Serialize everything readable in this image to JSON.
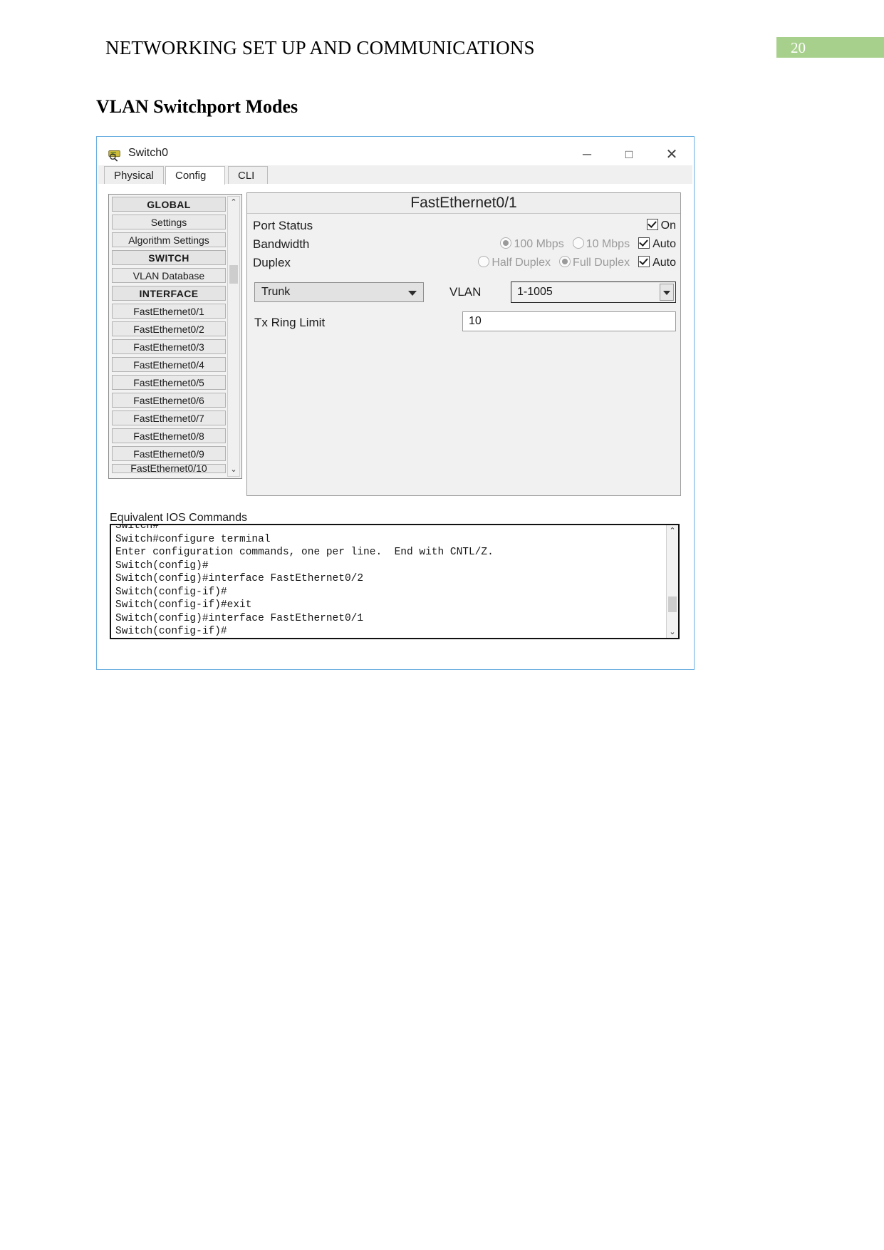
{
  "document": {
    "header_title": "NETWORKING SET UP AND COMMUNICATIONS",
    "page_number": "20",
    "section_heading": "VLAN Switchport Modes",
    "badge_color": "#a8d08d"
  },
  "window": {
    "title": "Switch0",
    "minimize": "─",
    "maximize": "□",
    "close": "✕"
  },
  "tabs": [
    {
      "label": "Physical",
      "active": false
    },
    {
      "label": "Config",
      "active": true
    },
    {
      "label": "CLI",
      "active": false
    }
  ],
  "sidebar": {
    "items": [
      {
        "label": "GLOBAL",
        "type": "header"
      },
      {
        "label": "Settings",
        "type": "item"
      },
      {
        "label": "Algorithm Settings",
        "type": "item"
      },
      {
        "label": "SWITCH",
        "type": "header"
      },
      {
        "label": "VLAN Database",
        "type": "item"
      },
      {
        "label": "INTERFACE",
        "type": "header"
      },
      {
        "label": "FastEthernet0/1",
        "type": "item"
      },
      {
        "label": "FastEthernet0/2",
        "type": "item"
      },
      {
        "label": "FastEthernet0/3",
        "type": "item"
      },
      {
        "label": "FastEthernet0/4",
        "type": "item"
      },
      {
        "label": "FastEthernet0/5",
        "type": "item"
      },
      {
        "label": "FastEthernet0/6",
        "type": "item"
      },
      {
        "label": "FastEthernet0/7",
        "type": "item"
      },
      {
        "label": "FastEthernet0/8",
        "type": "item"
      },
      {
        "label": "FastEthernet0/9",
        "type": "item"
      },
      {
        "label": "FastEthernet0/10",
        "type": "item"
      }
    ],
    "scroll_up": "⌃",
    "scroll_down": "⌄"
  },
  "config": {
    "panel_title": "FastEthernet0/1",
    "port_status_label": "Port Status",
    "port_status_on_label": "On",
    "port_status_on_checked": true,
    "bandwidth_label": "Bandwidth",
    "bandwidth_100_label": "100 Mbps",
    "bandwidth_10_label": "10 Mbps",
    "bandwidth_auto_label": "Auto",
    "bandwidth_selected": "100 Mbps",
    "bandwidth_auto_checked": true,
    "duplex_label": "Duplex",
    "duplex_half_label": "Half Duplex",
    "duplex_full_label": "Full Duplex",
    "duplex_auto_label": "Auto",
    "duplex_selected": "Full Duplex",
    "duplex_auto_checked": true,
    "switchport_mode_value": "Trunk",
    "vlan_label": "VLAN",
    "vlan_value": "1-1005",
    "tx_ring_limit_label": "Tx Ring Limit",
    "tx_ring_limit_value": "10"
  },
  "ios": {
    "label": "Equivalent IOS Commands",
    "lines": "Switch#\nSwitch#configure terminal\nEnter configuration commands, one per line.  End with CNTL/Z.\nSwitch(config)#\nSwitch(config)#interface FastEthernet0/2\nSwitch(config-if)#\nSwitch(config-if)#exit\nSwitch(config)#interface FastEthernet0/1\nSwitch(config-if)#",
    "scroll_up": "⌃",
    "scroll_down": "⌄"
  }
}
